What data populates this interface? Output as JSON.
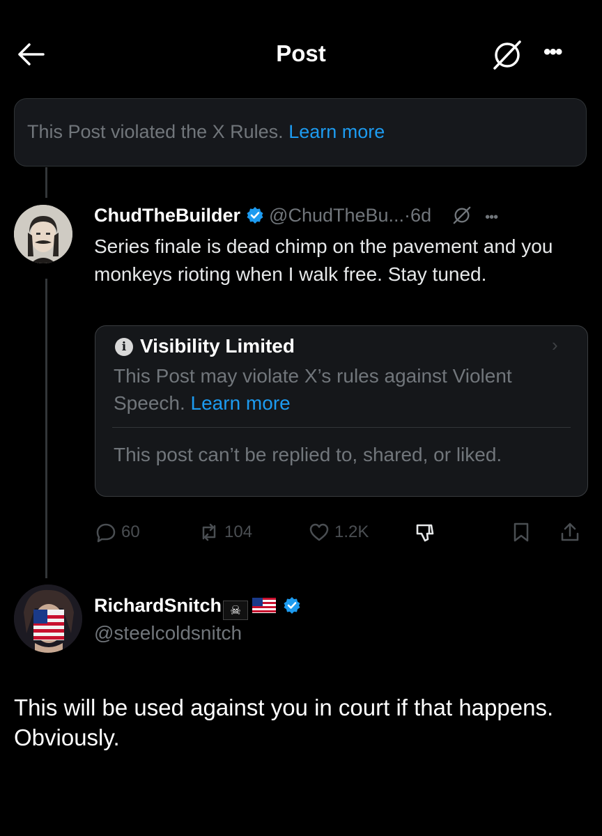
{
  "header": {
    "title": "Post",
    "more_label": "•••"
  },
  "notice": {
    "text": "This Post violated the X Rules.",
    "link": "Learn more"
  },
  "post": {
    "display_name": "ChudTheBuilder",
    "handle": "@ChudTheBu...",
    "separator": "·",
    "age": "6d",
    "more_label": "•••",
    "text": "Series finale is dead chimp on the pavement and you monkeys rioting when I walk free. Stay tuned.",
    "visibility": {
      "title": "Visibility Limited",
      "info_icon_glyph": "i",
      "description": "This Post may violate X’s rules against Violent Speech.",
      "link": "Learn more",
      "note": "This post can’t be replied to, shared, or liked.",
      "chevron": "›"
    },
    "stats": {
      "replies": "60",
      "reposts": "104",
      "likes": "1.2K"
    }
  },
  "reply": {
    "display_name": "RichardSnitch",
    "pirate_flag": "☠",
    "handle": "@steelcoldsnitch",
    "text": "This will be used against you in court if that happens. Obviously."
  },
  "colors": {
    "background": "#000000",
    "accent": "#1d9bf0",
    "muted": "#71767b",
    "verified": "#1d9bf0"
  },
  "icons": [
    "back-arrow-icon",
    "grok-icon",
    "more-icon",
    "verified-icon",
    "info-icon",
    "reply-icon",
    "repost-icon",
    "like-icon",
    "downvote-icon",
    "bookmark-icon",
    "share-icon"
  ]
}
